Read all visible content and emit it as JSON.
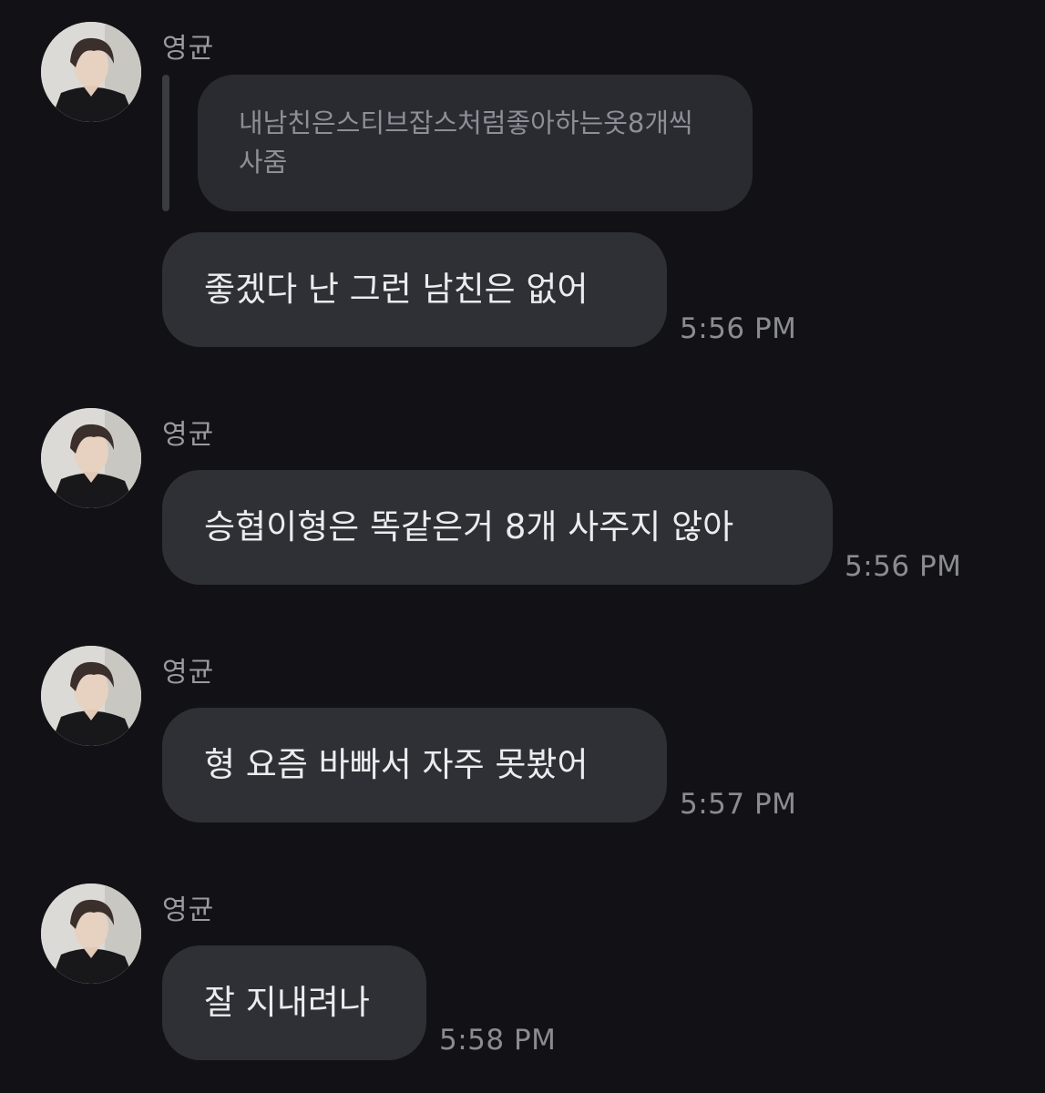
{
  "colors": {
    "background": "#121216",
    "bubble": "#2f3036",
    "quote_bubble": "#2a2b31",
    "text": "#ececef",
    "muted": "#8b8c92"
  },
  "messages": [
    {
      "sender": "영균",
      "avatar_icon": "profile-photo-icon",
      "quoted_text": "내남친은스티브잡스처럼좋아하는옷8개씩사줌",
      "text": "좋겠다 난 그런 남친은 없어",
      "time": "5:56 PM"
    },
    {
      "sender": "영균",
      "avatar_icon": "profile-photo-icon",
      "text": "승협이형은 똑같은거 8개 사주지 않아",
      "time": "5:56 PM"
    },
    {
      "sender": "영균",
      "avatar_icon": "profile-photo-icon",
      "text": "형 요즘 바빠서 자주 못봤어",
      "time": "5:57 PM"
    },
    {
      "sender": "영균",
      "avatar_icon": "profile-photo-icon",
      "text": "잘 지내려나",
      "time": "5:58 PM"
    }
  ]
}
